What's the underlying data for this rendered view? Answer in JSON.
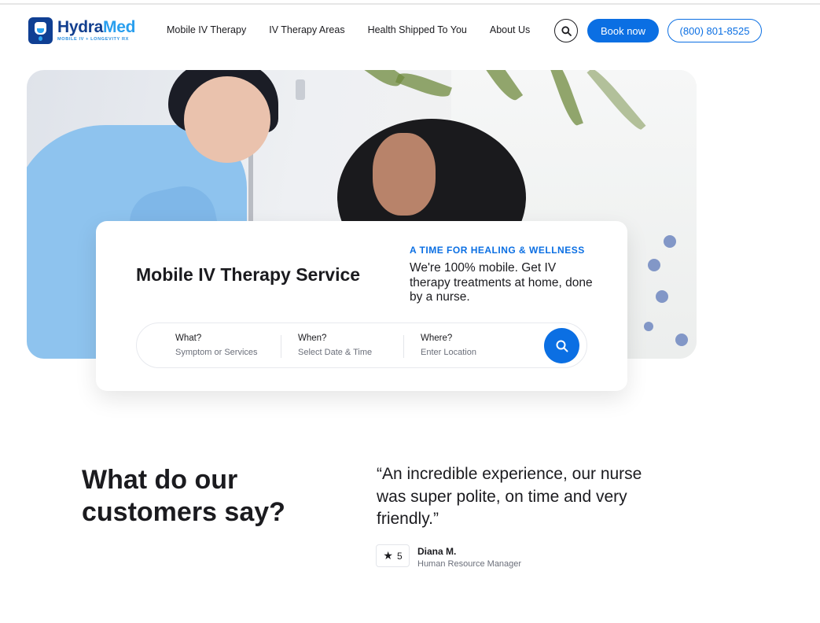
{
  "logo": {
    "name_part1": "Hydra",
    "name_part2": "Med",
    "tagline": "MOBILE IV + LONGEVITY RX"
  },
  "nav": {
    "items": [
      {
        "label": "Mobile IV Therapy"
      },
      {
        "label": "IV Therapy Areas"
      },
      {
        "label": "Health Shipped To You"
      },
      {
        "label": "About Us"
      }
    ],
    "book_label": "Book now",
    "phone_label": "(800) 801-8525"
  },
  "hero": {
    "title": "Mobile IV Therapy Service",
    "eyebrow": "A TIME FOR HEALING & WELLNESS",
    "description": "We're 100% mobile. Get IV therapy treatments at home, done by a nurse."
  },
  "search": {
    "fields": [
      {
        "label": "What?",
        "placeholder": "Symptom or Services"
      },
      {
        "label": "When?",
        "placeholder": "Select Date & Time"
      },
      {
        "label": "Where?",
        "placeholder": "Enter Location"
      }
    ]
  },
  "testimonials": {
    "heading": "What do our customers say?",
    "quote": "“An incredible experience, our nurse was super polite, on time and very friendly.”",
    "rating": "5",
    "author_name": "Diana M.",
    "author_role": "Human Resource Manager"
  },
  "colors": {
    "accent": "#0b6fe3",
    "logo_dark": "#123f8f",
    "logo_light": "#2a9fee"
  },
  "icons": {
    "header_search": "search-icon",
    "search_submit": "search-icon",
    "rating": "star-icon"
  }
}
